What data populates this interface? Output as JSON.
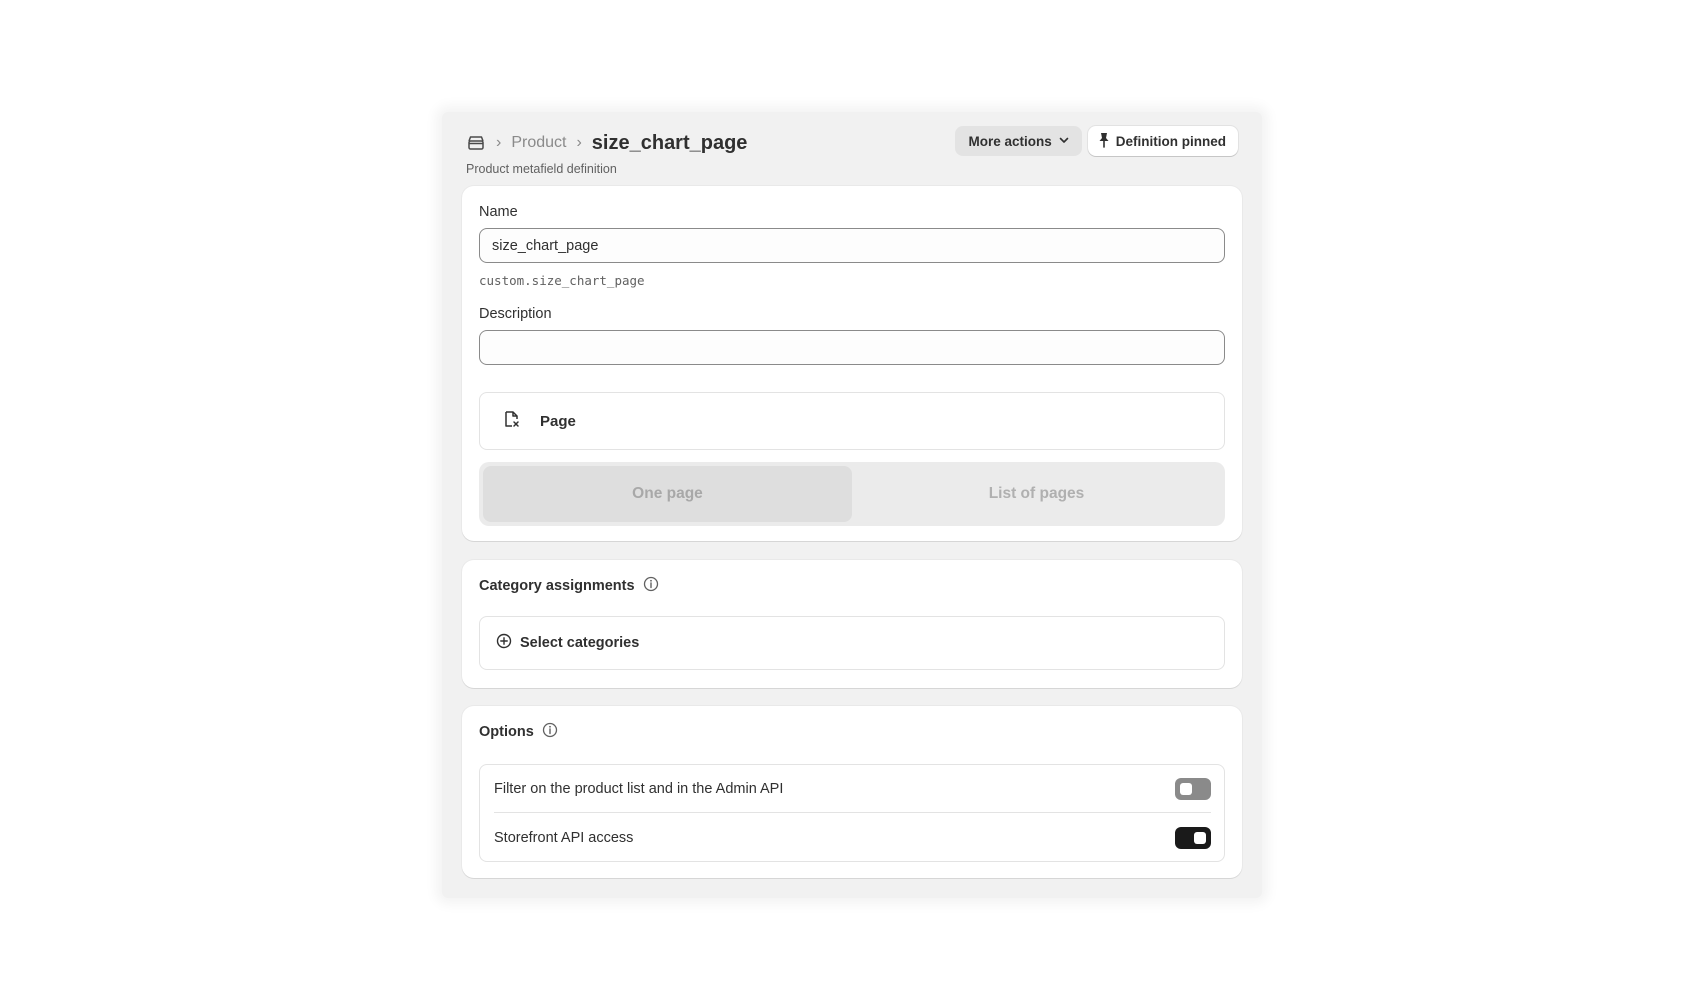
{
  "header": {
    "breadcrumb_parent": "Product",
    "title": "size_chart_page",
    "subtitle": "Product metafield definition",
    "more_actions_label": "More actions",
    "pinned_label": "Definition pinned"
  },
  "definition": {
    "name_label": "Name",
    "name_value": "size_chart_page",
    "namespace_key": "custom.size_chart_page",
    "description_label": "Description",
    "description_value": "",
    "type_label": "Page",
    "segments": [
      {
        "label": "One page",
        "selected": true
      },
      {
        "label": "List of pages",
        "selected": false
      }
    ]
  },
  "categories": {
    "title": "Category assignments",
    "select_label": "Select categories"
  },
  "options": {
    "title": "Options",
    "items": [
      {
        "label": "Filter on the product list and in the Admin API",
        "enabled": false
      },
      {
        "label": "Storefront API access",
        "enabled": true
      }
    ]
  },
  "icons": {
    "breadcrumb": "store-icon",
    "dropdown": "chevron-down-icon",
    "pin": "pin-icon",
    "type": "page-icon",
    "info": "info-icon",
    "add": "plus-circle-icon"
  }
}
